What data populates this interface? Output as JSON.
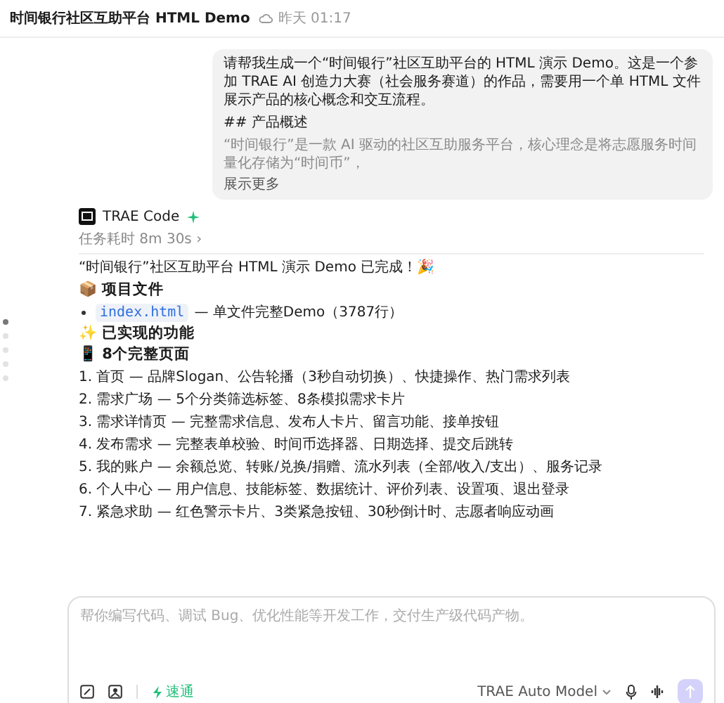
{
  "header": {
    "title": "时间银行社区互助平台 HTML Demo",
    "timestamp": "昨天 01:17"
  },
  "user_message": {
    "paragraphs": [
      "请帮我生成一个“时间银行”社区互助平台的 HTML 演示 Demo。这是一个参加 TRAE AI 创造力大赛（社会服务赛道）的作品，需要用一个单 HTML 文件展示产品的核心概念和交互流程。",
      "## 产品概述"
    ],
    "faded_line": "“时间银行”是一款 AI 驱动的社区互助服务平台，核心理念是将志愿服务时间量化存储为“时间币”，",
    "expand_link": "展示更多"
  },
  "outline_markers": [
    {
      "selected": true
    },
    {
      "selected": false
    },
    {
      "selected": false
    },
    {
      "selected": false
    },
    {
      "selected": false
    }
  ],
  "assistant": {
    "name": "TRAE Code",
    "duration": "任务耗时 8m 30s ›",
    "intro": "“时间银行”社区互助平台 HTML 演示 Demo 已完成！🎉",
    "sections": [
      {
        "kind": "heading",
        "emoji": "📦",
        "text": "项目文件"
      },
      {
        "kind": "file",
        "file": "index.html",
        "text": "— 单文件完整Demo（3787行）"
      },
      {
        "kind": "heading",
        "emoji": "✨",
        "text": "已实现的功能"
      },
      {
        "kind": "heading",
        "emoji": "📱",
        "text": "8个完整页面"
      },
      {
        "kind": "item",
        "text": "1. 首页 — 品牌Slogan、公告轮播（3秒自动切换）、快捷操作、热门需求列表"
      },
      {
        "kind": "item",
        "text": "2. 需求广场 — 5个分类筛选标签、8条模拟需求卡片"
      },
      {
        "kind": "item",
        "text": "3. 需求详情页 — 完整需求信息、发布人卡片、留言功能、接单按钮"
      },
      {
        "kind": "item",
        "text": "4. 发布需求 — 完整表单校验、时间币选择器、日期选择、提交后跳转"
      },
      {
        "kind": "item",
        "text": "5. 我的账户 — 余额总览、转账/兑换/捐赠、流水列表（全部/收入/支出）、服务记录"
      },
      {
        "kind": "item",
        "text": "6. 个人中心 — 用户信息、技能标签、数据统计、评价列表、设置项、退出登录"
      },
      {
        "kind": "item",
        "text": "7. 紧急求助 — 红色警示卡片、3类紧急按钮、30秒倒计时、志愿者响应动画"
      }
    ]
  },
  "composer": {
    "placeholder": "帮你编写代码、调试 Bug、优化性能等开发工作，交付生产级代码产物。",
    "mode": "速通",
    "model": "TRAE Auto Model",
    "send_disabled": true
  }
}
